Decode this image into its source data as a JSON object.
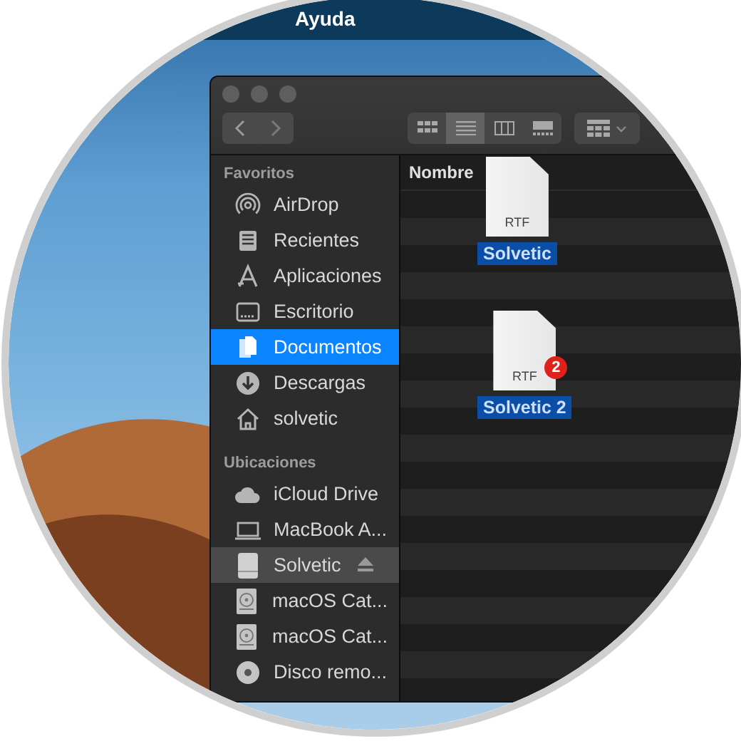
{
  "menu_bar": {
    "items": [
      "Ayuda"
    ]
  },
  "window": {
    "view_buttons": [
      {
        "selected": false
      },
      {
        "selected": true
      },
      {
        "selected": false
      },
      {
        "selected": false
      }
    ],
    "sidebar": {
      "sections": [
        {
          "title": "Favoritos",
          "items": [
            {
              "label": "AirDrop",
              "selected": false,
              "highlighted": false
            },
            {
              "label": "Recientes",
              "selected": false,
              "highlighted": false
            },
            {
              "label": "Aplicaciones",
              "selected": false,
              "highlighted": false
            },
            {
              "label": "Escritorio",
              "selected": false,
              "highlighted": false
            },
            {
              "label": "Documentos",
              "selected": true,
              "highlighted": false
            },
            {
              "label": "Descargas",
              "selected": false,
              "highlighted": false
            },
            {
              "label": "solvetic",
              "selected": false,
              "highlighted": false
            }
          ]
        },
        {
          "title": "Ubicaciones",
          "items": [
            {
              "label": "iCloud Drive",
              "selected": false,
              "highlighted": false
            },
            {
              "label": "MacBook A...",
              "selected": false,
              "highlighted": false
            },
            {
              "label": "Solvetic",
              "selected": false,
              "highlighted": true,
              "ejectable": true
            },
            {
              "label": "macOS Cat...",
              "selected": false,
              "highlighted": false
            },
            {
              "label": "macOS Cat...",
              "selected": false,
              "highlighted": false
            },
            {
              "label": "Disco remo...",
              "selected": false,
              "highlighted": false
            }
          ]
        }
      ]
    },
    "list": {
      "columns": [
        "Nombre"
      ]
    },
    "dragged_files": [
      {
        "type_label": "RTF",
        "label": "Solvetic"
      },
      {
        "type_label": "RTF",
        "label": "Solvetic 2",
        "badge": "2"
      }
    ]
  }
}
